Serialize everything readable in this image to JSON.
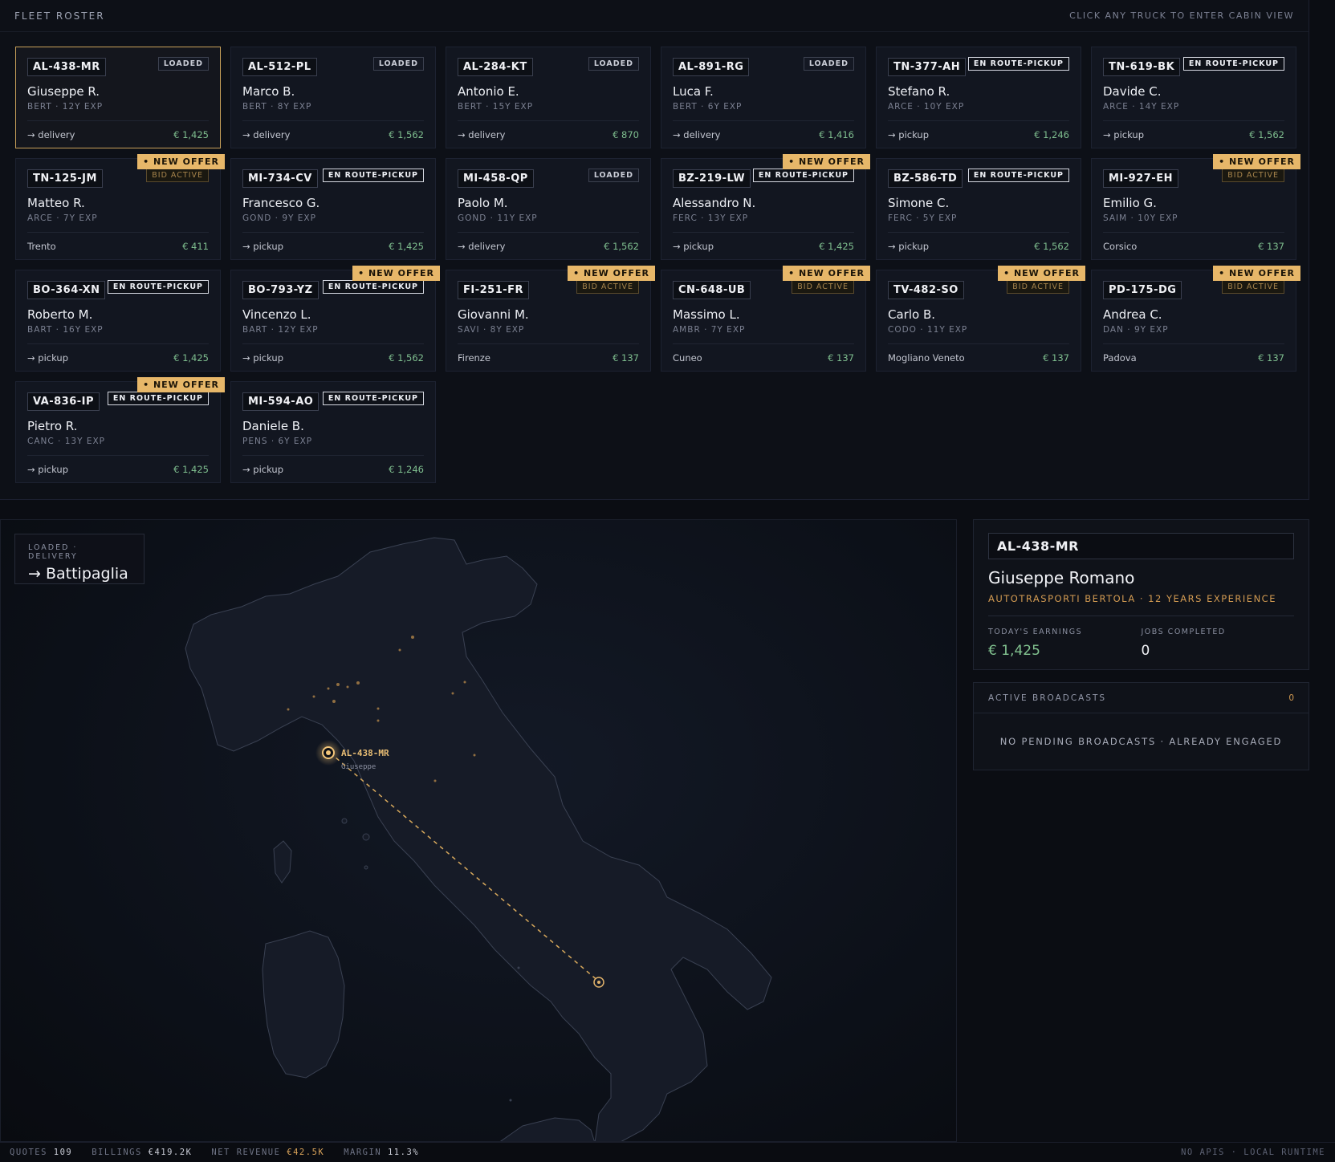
{
  "roster": {
    "title": "FLEET ROSTER",
    "hint": "CLICK ANY TRUCK TO ENTER CABIN VIEW",
    "trucks": [
      {
        "plate": "AL-438-MR",
        "status": "LOADED",
        "status_type": "loaded",
        "offer": "",
        "driver": "Giuseppe R.",
        "meta": "BERT · 12Y EXP",
        "dest": "→ delivery",
        "earn": "€ 1,425"
      },
      {
        "plate": "AL-512-PL",
        "status": "LOADED",
        "status_type": "loaded",
        "offer": "",
        "driver": "Marco B.",
        "meta": "BERT · 8Y EXP",
        "dest": "→ delivery",
        "earn": "€ 1,562"
      },
      {
        "plate": "AL-284-KT",
        "status": "LOADED",
        "status_type": "loaded",
        "offer": "",
        "driver": "Antonio E.",
        "meta": "BERT · 15Y EXP",
        "dest": "→ delivery",
        "earn": "€ 870"
      },
      {
        "plate": "AL-891-RG",
        "status": "LOADED",
        "status_type": "loaded",
        "offer": "",
        "driver": "Luca F.",
        "meta": "BERT · 6Y EXP",
        "dest": "→ delivery",
        "earn": "€ 1,416"
      },
      {
        "plate": "TN-377-AH",
        "status": "EN ROUTE-PICKUP",
        "status_type": "enroute",
        "offer": "",
        "driver": "Stefano R.",
        "meta": "ARCE · 10Y EXP",
        "dest": "→ pickup",
        "earn": "€ 1,246"
      },
      {
        "plate": "TN-619-BK",
        "status": "EN ROUTE-PICKUP",
        "status_type": "enroute",
        "offer": "",
        "driver": "Davide C.",
        "meta": "ARCE · 14Y EXP",
        "dest": "→ pickup",
        "earn": "€ 1,562"
      },
      {
        "plate": "TN-125-JM",
        "status": "BID ACTIVE",
        "status_type": "bid",
        "offer": "• NEW OFFER",
        "driver": "Matteo R.",
        "meta": "ARCE · 7Y EXP",
        "dest": "Trento",
        "earn": "€ 411"
      },
      {
        "plate": "MI-734-CV",
        "status": "EN ROUTE-PICKUP",
        "status_type": "enroute",
        "offer": "",
        "driver": "Francesco G.",
        "meta": "GOND · 9Y EXP",
        "dest": "→ pickup",
        "earn": "€ 1,425"
      },
      {
        "plate": "MI-458-QP",
        "status": "LOADED",
        "status_type": "loaded",
        "offer": "",
        "driver": "Paolo M.",
        "meta": "GOND · 11Y EXP",
        "dest": "→ delivery",
        "earn": "€ 1,562"
      },
      {
        "plate": "BZ-219-LW",
        "status": "EN ROUTE-PICKUP",
        "status_type": "enroute",
        "offer": "• NEW OFFER",
        "driver": "Alessandro N.",
        "meta": "FERC · 13Y EXP",
        "dest": "→ pickup",
        "earn": "€ 1,425"
      },
      {
        "plate": "BZ-586-TD",
        "status": "EN ROUTE-PICKUP",
        "status_type": "enroute",
        "offer": "",
        "driver": "Simone C.",
        "meta": "FERC · 5Y EXP",
        "dest": "→ pickup",
        "earn": "€ 1,562"
      },
      {
        "plate": "MI-927-EH",
        "status": "BID ACTIVE",
        "status_type": "bid",
        "offer": "• NEW OFFER",
        "driver": "Emilio G.",
        "meta": "SAIM · 10Y EXP",
        "dest": "Corsico",
        "earn": "€ 137"
      },
      {
        "plate": "BO-364-XN",
        "status": "EN ROUTE-PICKUP",
        "status_type": "enroute",
        "offer": "",
        "driver": "Roberto M.",
        "meta": "BART · 16Y EXP",
        "dest": "→ pickup",
        "earn": "€ 1,425"
      },
      {
        "plate": "BO-793-YZ",
        "status": "EN ROUTE-PICKUP",
        "status_type": "enroute",
        "offer": "• NEW OFFER",
        "driver": "Vincenzo L.",
        "meta": "BART · 12Y EXP",
        "dest": "→ pickup",
        "earn": "€ 1,562"
      },
      {
        "plate": "FI-251-FR",
        "status": "BID ACTIVE",
        "status_type": "bid",
        "offer": "• NEW OFFER",
        "driver": "Giovanni M.",
        "meta": "SAVI · 8Y EXP",
        "dest": "Firenze",
        "earn": "€ 137"
      },
      {
        "plate": "CN-648-UB",
        "status": "BID ACTIVE",
        "status_type": "bid",
        "offer": "• NEW OFFER",
        "driver": "Massimo L.",
        "meta": "AMBR · 7Y EXP",
        "dest": "Cuneo",
        "earn": "€ 137"
      },
      {
        "plate": "TV-482-SO",
        "status": "BID ACTIVE",
        "status_type": "bid",
        "offer": "• NEW OFFER",
        "driver": "Carlo B.",
        "meta": "CODO · 11Y EXP",
        "dest": "Mogliano Veneto",
        "earn": "€ 137"
      },
      {
        "plate": "PD-175-DG",
        "status": "BID ACTIVE",
        "status_type": "bid",
        "offer": "• NEW OFFER",
        "driver": "Andrea C.",
        "meta": "DAN · 9Y EXP",
        "dest": "Padova",
        "earn": "€ 137"
      },
      {
        "plate": "VA-836-IP",
        "status": "EN ROUTE-PICKUP",
        "status_type": "enroute",
        "offer": "• NEW OFFER",
        "driver": "Pietro R.",
        "meta": "CANC · 13Y EXP",
        "dest": "→ pickup",
        "earn": "€ 1,425"
      },
      {
        "plate": "MI-594-AO",
        "status": "EN ROUTE-PICKUP",
        "status_type": "enroute",
        "offer": "",
        "driver": "Daniele B.",
        "meta": "PENS · 6Y EXP",
        "dest": "→ pickup",
        "earn": "€ 1,246"
      }
    ]
  },
  "map": {
    "route_kicker": "LOADED · DELIVERY",
    "route_dest": "→ Battipaglia",
    "pin_plate": "AL-438-MR",
    "pin_driver": "Giuseppe"
  },
  "driver_panel": {
    "plate": "AL-438-MR",
    "name": "Giuseppe Romano",
    "company": "AUTOTRASPORTI BERTOLA · 12 YEARS EXPERIENCE",
    "earnings_label": "TODAY'S EARNINGS",
    "earnings_value": "€ 1,425",
    "jobs_label": "JOBS COMPLETED",
    "jobs_value": "0"
  },
  "broadcasts": {
    "title": "ACTIVE BROADCASTS",
    "count": "0",
    "empty": "NO PENDING BROADCASTS · ALREADY ENGAGED"
  },
  "statusbar": {
    "quotes_label": "QUOTES",
    "quotes_value": "109",
    "billings_label": "BILLINGS",
    "billings_value": "€419.2K",
    "revenue_label": "NET REVENUE",
    "revenue_value": "€42.5K",
    "margin_label": "MARGIN",
    "margin_value": "11.3%",
    "runtime": "NO APIS · LOCAL RUNTIME"
  },
  "colors": {
    "accent": "#e7b769",
    "earn_green": "#7fbf8f",
    "background": "#0b0d13"
  }
}
